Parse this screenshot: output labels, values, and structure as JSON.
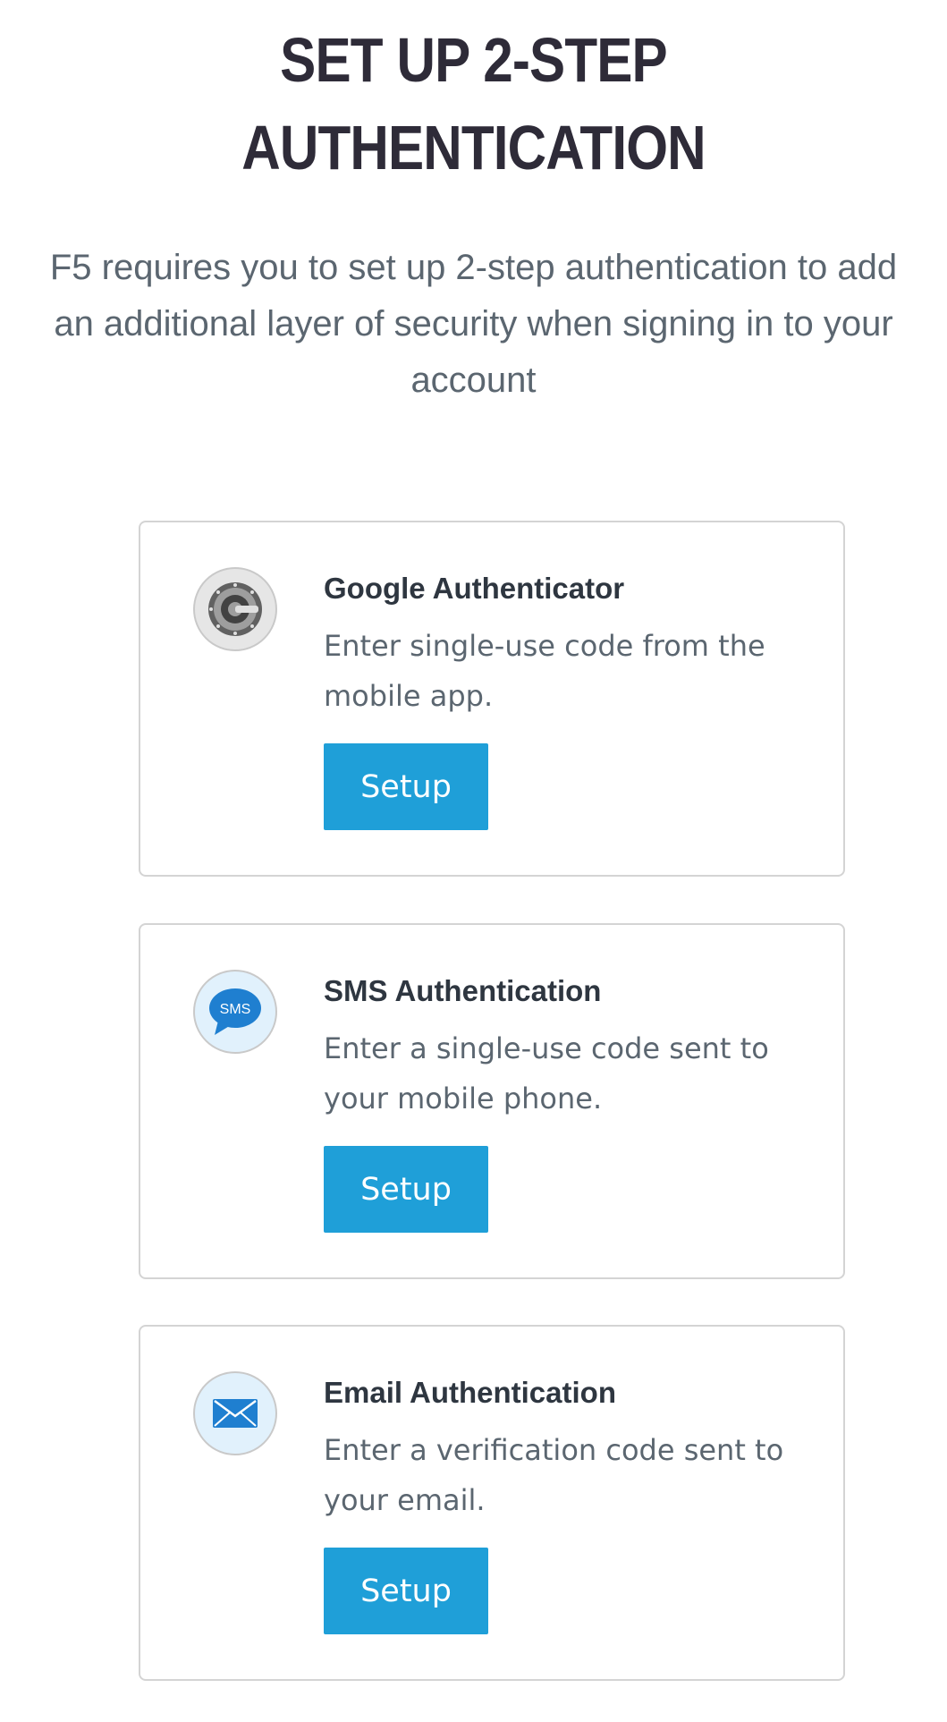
{
  "page": {
    "title": "SET UP 2-STEP AUTHENTICATION",
    "subtitle": "F5 requires you to set up 2-step authentication to add an additional layer of security when signing in to your account"
  },
  "methods": [
    {
      "id": "google",
      "icon": "google-authenticator-icon",
      "title": "Google Authenticator",
      "description": "Enter single-use code from the mobile app.",
      "button_label": "Setup"
    },
    {
      "id": "sms",
      "icon": "sms-bubble-icon",
      "icon_text": "SMS",
      "title": "SMS Authentication",
      "description": "Enter a single-use code sent to your mobile phone.",
      "button_label": "Setup"
    },
    {
      "id": "email",
      "icon": "envelope-icon",
      "title": "Email Authentication",
      "description": "Enter a verification code sent to your email.",
      "button_label": "Setup"
    }
  ],
  "colors": {
    "title_text": "#2e2b38",
    "body_text": "#5b6670",
    "button_background": "#1f9fd8",
    "button_text": "#ffffff",
    "card_border": "#d4d4d4",
    "icon_background_light_blue": "#e1f1fc",
    "icon_background_gray": "#e6e6e6"
  }
}
